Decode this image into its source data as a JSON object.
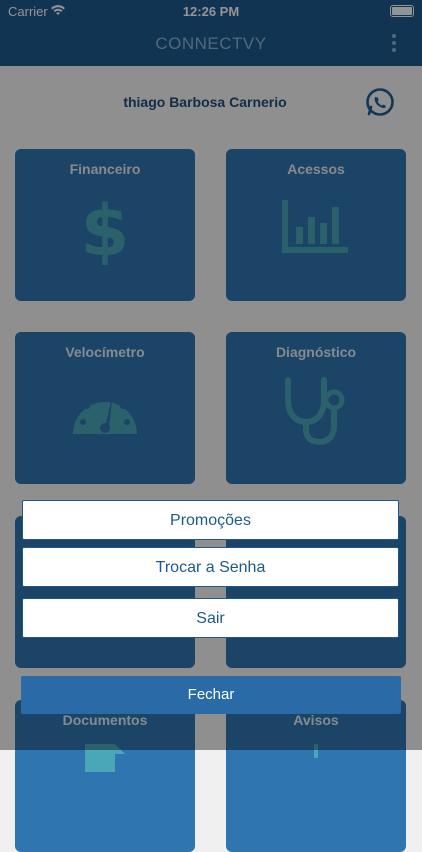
{
  "status": {
    "carrier": "Carrier",
    "time": "12:26 PM"
  },
  "navbar": {
    "title": "CONNECTVY"
  },
  "user": {
    "name": "thiago Barbosa Carnerio"
  },
  "tiles": [
    {
      "label": "Financeiro",
      "icon": "dollar-icon"
    },
    {
      "label": "Acessos",
      "icon": "bar-chart-icon"
    },
    {
      "label": "Velocímetro",
      "icon": "speedometer-icon"
    },
    {
      "label": "Diagnóstico",
      "icon": "stethoscope-icon"
    },
    {
      "label": "Documentos",
      "icon": "document-icon"
    },
    {
      "label": "Avisos",
      "icon": "notice-icon"
    }
  ],
  "action_sheet": {
    "items": [
      "Promoções",
      "Trocar a Senha",
      "Sair"
    ],
    "close_label": "Fechar"
  }
}
